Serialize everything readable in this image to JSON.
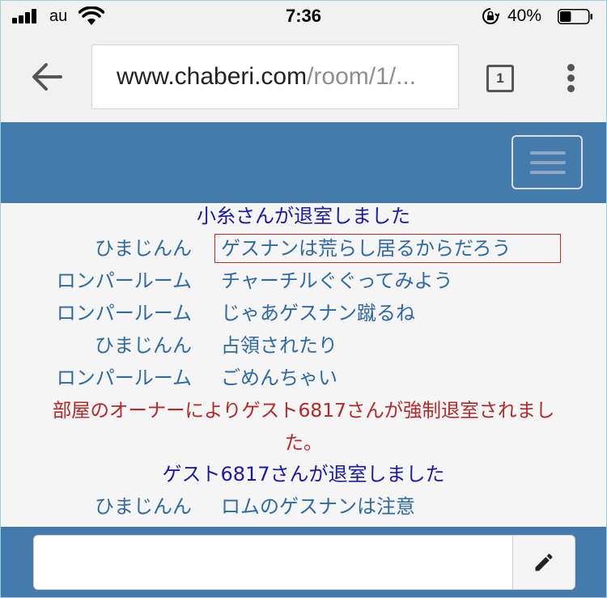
{
  "status_bar": {
    "carrier": "au",
    "time": "7:36",
    "battery_percent": "40%",
    "battery_level": 0.4,
    "icons": [
      "signal-icon",
      "wifi-icon",
      "rotation-lock-icon",
      "battery-icon"
    ]
  },
  "browser": {
    "url_host": "www.chaberi.com",
    "url_path": "/room/1/...",
    "tab_count": "1",
    "icons": [
      "back-arrow-icon",
      "tab-switcher-icon",
      "more-vert-icon"
    ]
  },
  "site": {
    "menu_icon": "hamburger-icon"
  },
  "chat": {
    "system_1": "小糸さんが退室しました",
    "messages": [
      {
        "name": "ひまじんん",
        "text": "ゲスナンは荒らし居るからだろう"
      },
      {
        "name": "ロンパールーム",
        "text": "チャーチルぐぐってみよう"
      },
      {
        "name": "ロンパールーム",
        "text": "じゃあゲスナン蹴るね"
      },
      {
        "name": "ひまじんん",
        "text": "占領されたり"
      },
      {
        "name": "ロンパールーム",
        "text": "ごめんちゃい"
      }
    ],
    "warning_line1": "部屋のオーナーによりゲスト6817さんが強制退室されまし",
    "warning_line2": "た。",
    "system_2": "ゲスト6817さんが退室しました",
    "last_message": {
      "name": "ひまじんん",
      "text": "ロムのゲスナンは注意"
    }
  },
  "input": {
    "placeholder": "",
    "value": "",
    "send_icon": "pencil-icon"
  },
  "colors": {
    "header_blue": "#447bac",
    "system_text": "#1a1aa8",
    "user_text": "#2e6aa3",
    "warning_text": "#b22a2a",
    "highlight_border": "#c62828"
  }
}
